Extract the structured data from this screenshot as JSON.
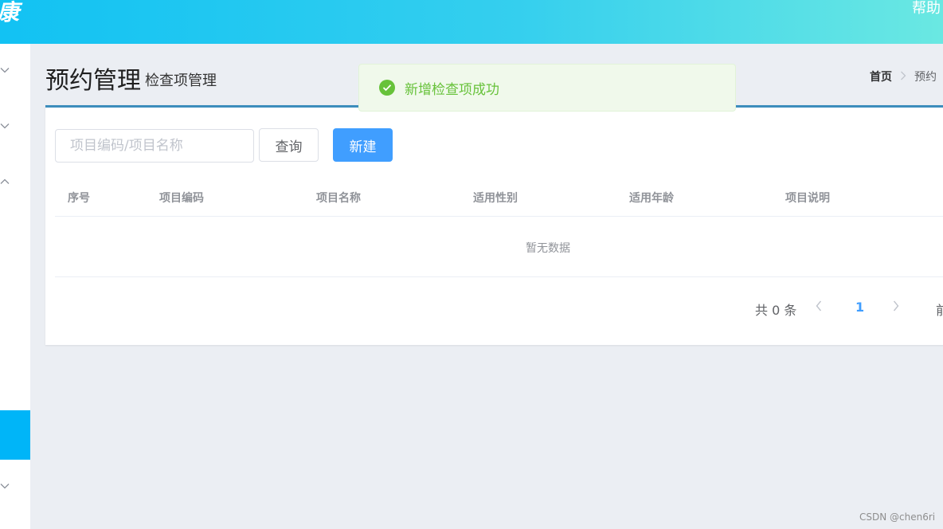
{
  "header": {
    "logo_fragment": "康",
    "help_label": "帮助"
  },
  "page": {
    "title": "预约管理",
    "subtitle": "检查项管理"
  },
  "breadcrumb": {
    "home": "首页",
    "current": "预约"
  },
  "toolbar": {
    "search_placeholder": "项目编码/项目名称",
    "query_label": "查询",
    "new_label": "新建"
  },
  "table": {
    "columns": [
      "序号",
      "项目编码",
      "项目名称",
      "适用性别",
      "适用年龄",
      "项目说明"
    ],
    "empty_text": "暂无数据"
  },
  "pagination": {
    "total_text": "共 0 条",
    "current_page": "1",
    "goto_fragment": "前"
  },
  "toast": {
    "message": "新增检查项成功",
    "type": "success"
  },
  "watermark": "CSDN @chen6ri",
  "colors": {
    "primary": "#409eff",
    "success": "#67c23a",
    "sidebar_active": "#00b5f8",
    "panel_border": "#3c8dbc"
  }
}
